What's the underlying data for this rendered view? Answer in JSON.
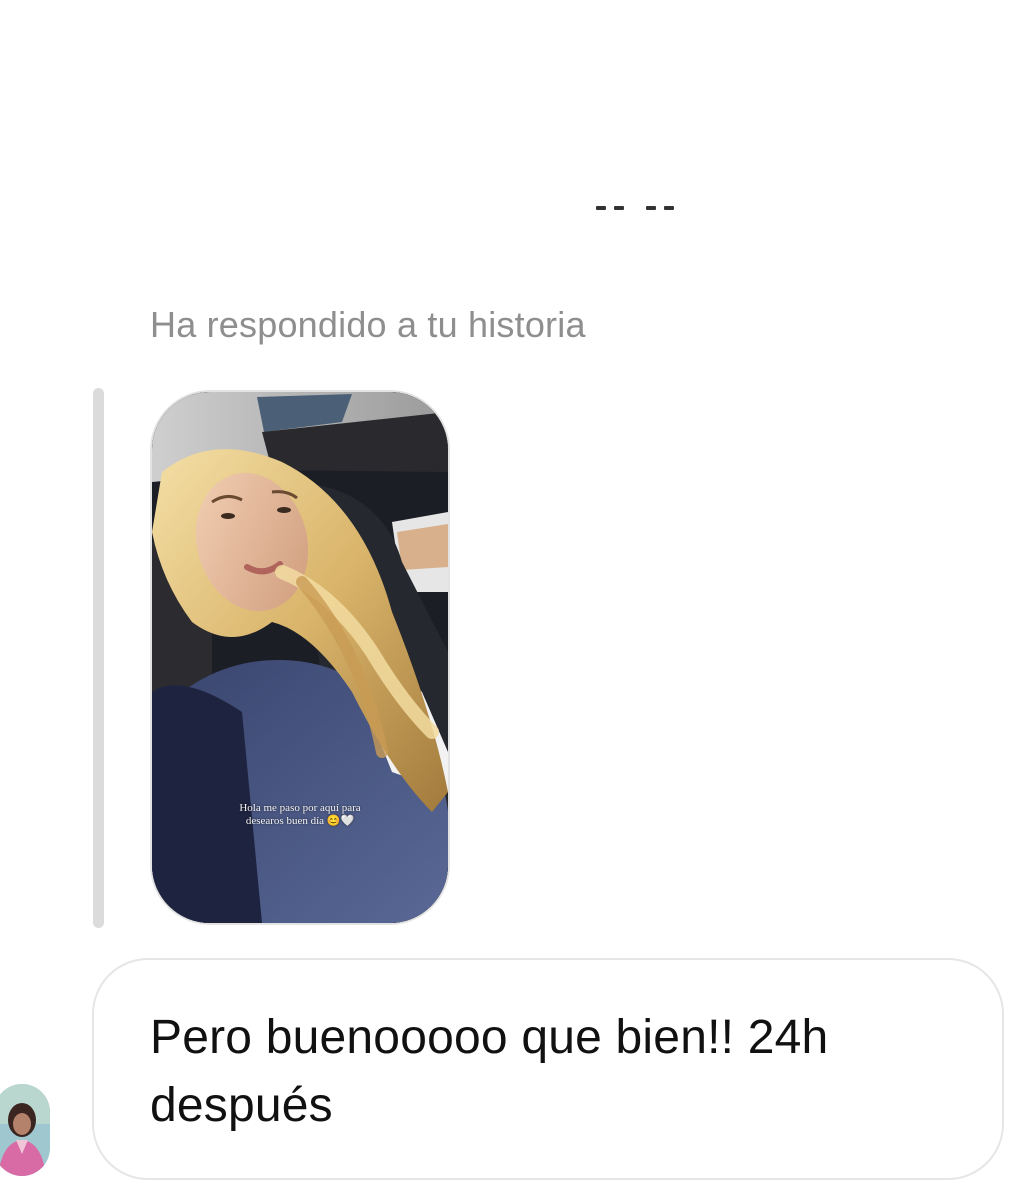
{
  "conversation": {
    "story_reply_label": "Ha respondido a tu historia",
    "story": {
      "caption_line1": "Hola me paso por aquí para",
      "caption_line2": "desearos buen día 😊🤍",
      "image": "selfie-in-car"
    },
    "message": {
      "text": "Pero buenooooo que bien!! 24h después",
      "sender_avatar": "avatar-photo"
    }
  },
  "colors": {
    "background": "#ffffff",
    "secondary_text": "#8e8e8e",
    "reply_bar": "#dbdbdb",
    "bubble_border": "#e6e6e6",
    "message_text": "#111111"
  }
}
